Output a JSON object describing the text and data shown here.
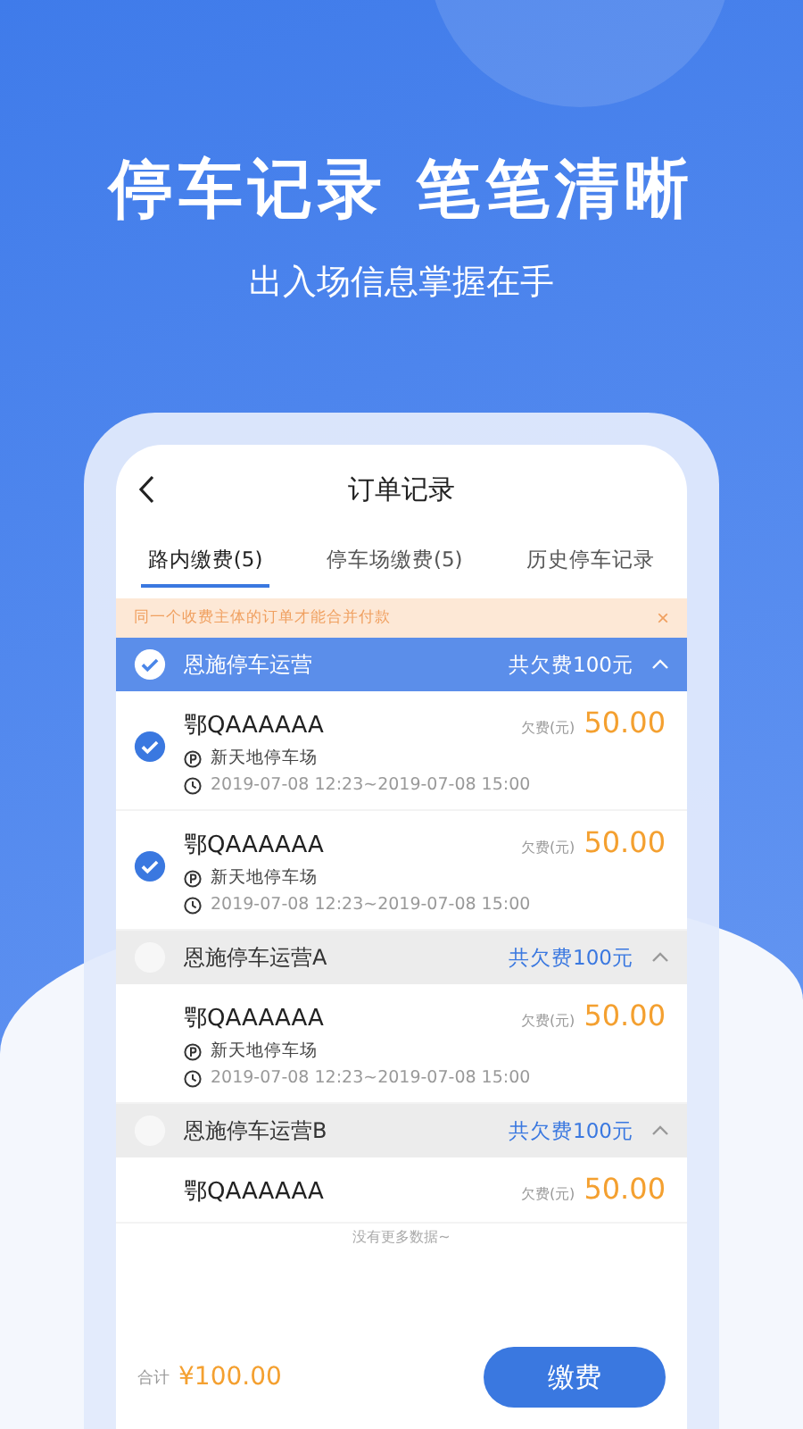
{
  "promo": {
    "headline": "停车记录 笔笔清晰",
    "subhead": "出入场信息掌握在手"
  },
  "nav": {
    "title": "订单记录"
  },
  "tabs": [
    {
      "label": "路内缴费(5)",
      "selected": true
    },
    {
      "label": "停车场缴费(5)",
      "selected": false
    },
    {
      "label": "历史停车记录",
      "selected": false
    }
  ],
  "notice": {
    "text": "同一个收费主体的订单才能合并付款",
    "close": "×"
  },
  "groups": [
    {
      "name": "恩施停车运营",
      "total": "共欠费100元",
      "checked": true,
      "items": [
        {
          "plate": "鄂QAAAAAA",
          "fee_label": "欠费(元)",
          "amount": "50.00",
          "place": "新天地停车场",
          "time": "2019-07-08 12:23~2019-07-08 15:00",
          "checked": true
        },
        {
          "plate": "鄂QAAAAAA",
          "fee_label": "欠费(元)",
          "amount": "50.00",
          "place": "新天地停车场",
          "time": "2019-07-08 12:23~2019-07-08 15:00",
          "checked": true
        }
      ]
    },
    {
      "name": "恩施停车运营A",
      "total": "共欠费100元",
      "checked": false,
      "items": [
        {
          "plate": "鄂QAAAAAA",
          "fee_label": "欠费(元)",
          "amount": "50.00",
          "place": "新天地停车场",
          "time": "2019-07-08 12:23~2019-07-08 15:00",
          "checked": false
        }
      ]
    },
    {
      "name": "恩施停车运营B",
      "total": "共欠费100元",
      "checked": false,
      "items": [
        {
          "plate": "鄂QAAAAAA",
          "fee_label": "欠费(元)",
          "amount": "50.00",
          "checked": false
        }
      ]
    }
  ],
  "end_note": "没有更多数据~",
  "footer": {
    "total_label": "合计",
    "total": "¥100.00",
    "pay_button": "缴费"
  }
}
